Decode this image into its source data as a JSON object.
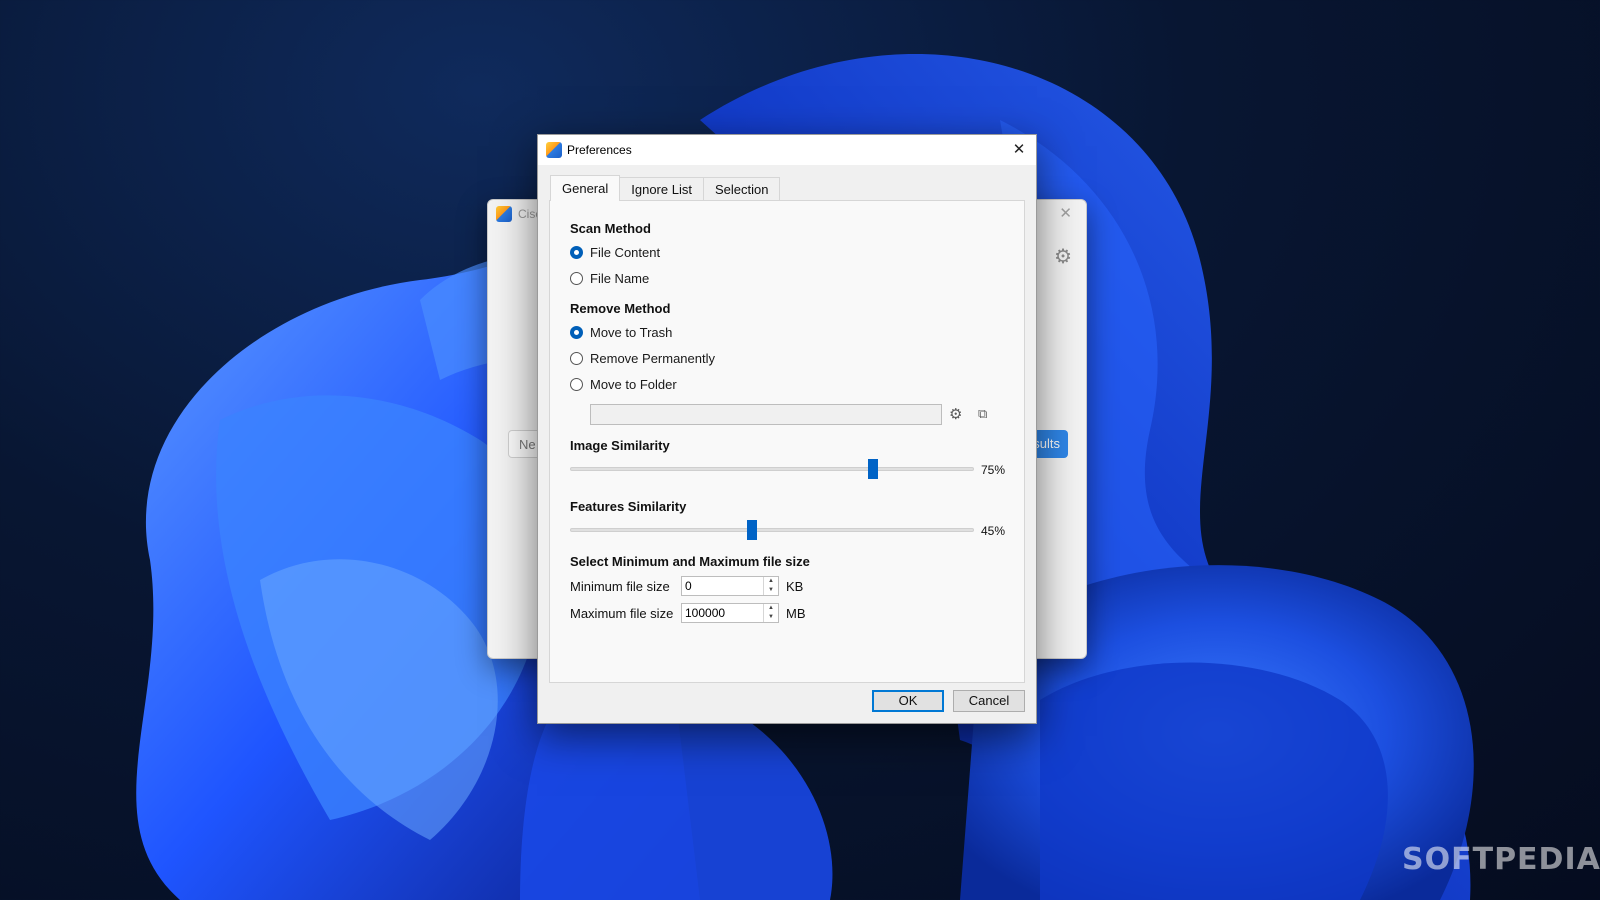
{
  "main_window": {
    "title": "Cisc",
    "new_button": "Ne",
    "results_button": "sults"
  },
  "dialog": {
    "title": "Preferences",
    "tabs": [
      "General",
      "Ignore List",
      "Selection"
    ],
    "active_tab": "General"
  },
  "scan_method": {
    "heading": "Scan Method",
    "options": [
      "File Content",
      "File Name"
    ],
    "selected": "File Content"
  },
  "remove_method": {
    "heading": "Remove Method",
    "options": [
      "Move to Trash",
      "Remove Permanently",
      "Move to Folder"
    ],
    "selected": "Move to Trash",
    "folder_path": ""
  },
  "image_similarity": {
    "heading": "Image Similarity",
    "value": 75,
    "label": "75%"
  },
  "features_similarity": {
    "heading": "Features Similarity",
    "value": 45,
    "label": "45%"
  },
  "file_size": {
    "heading": "Select Minimum and Maximum file size",
    "min_label": "Minimum file  size",
    "min_value": "0",
    "min_unit": "KB",
    "max_label": "Maximum file size",
    "max_value": "100000",
    "max_unit": "MB"
  },
  "buttons": {
    "ok": "OK",
    "cancel": "Cancel"
  },
  "watermark": "SOFTPEDIA",
  "icons": [
    "app-icon",
    "close-icon",
    "gear-icon",
    "open-external-icon"
  ],
  "colors": {
    "accent": "#005fb8",
    "slider_thumb": "#0063c6",
    "wallpaper_blue": "#1a5cff"
  }
}
